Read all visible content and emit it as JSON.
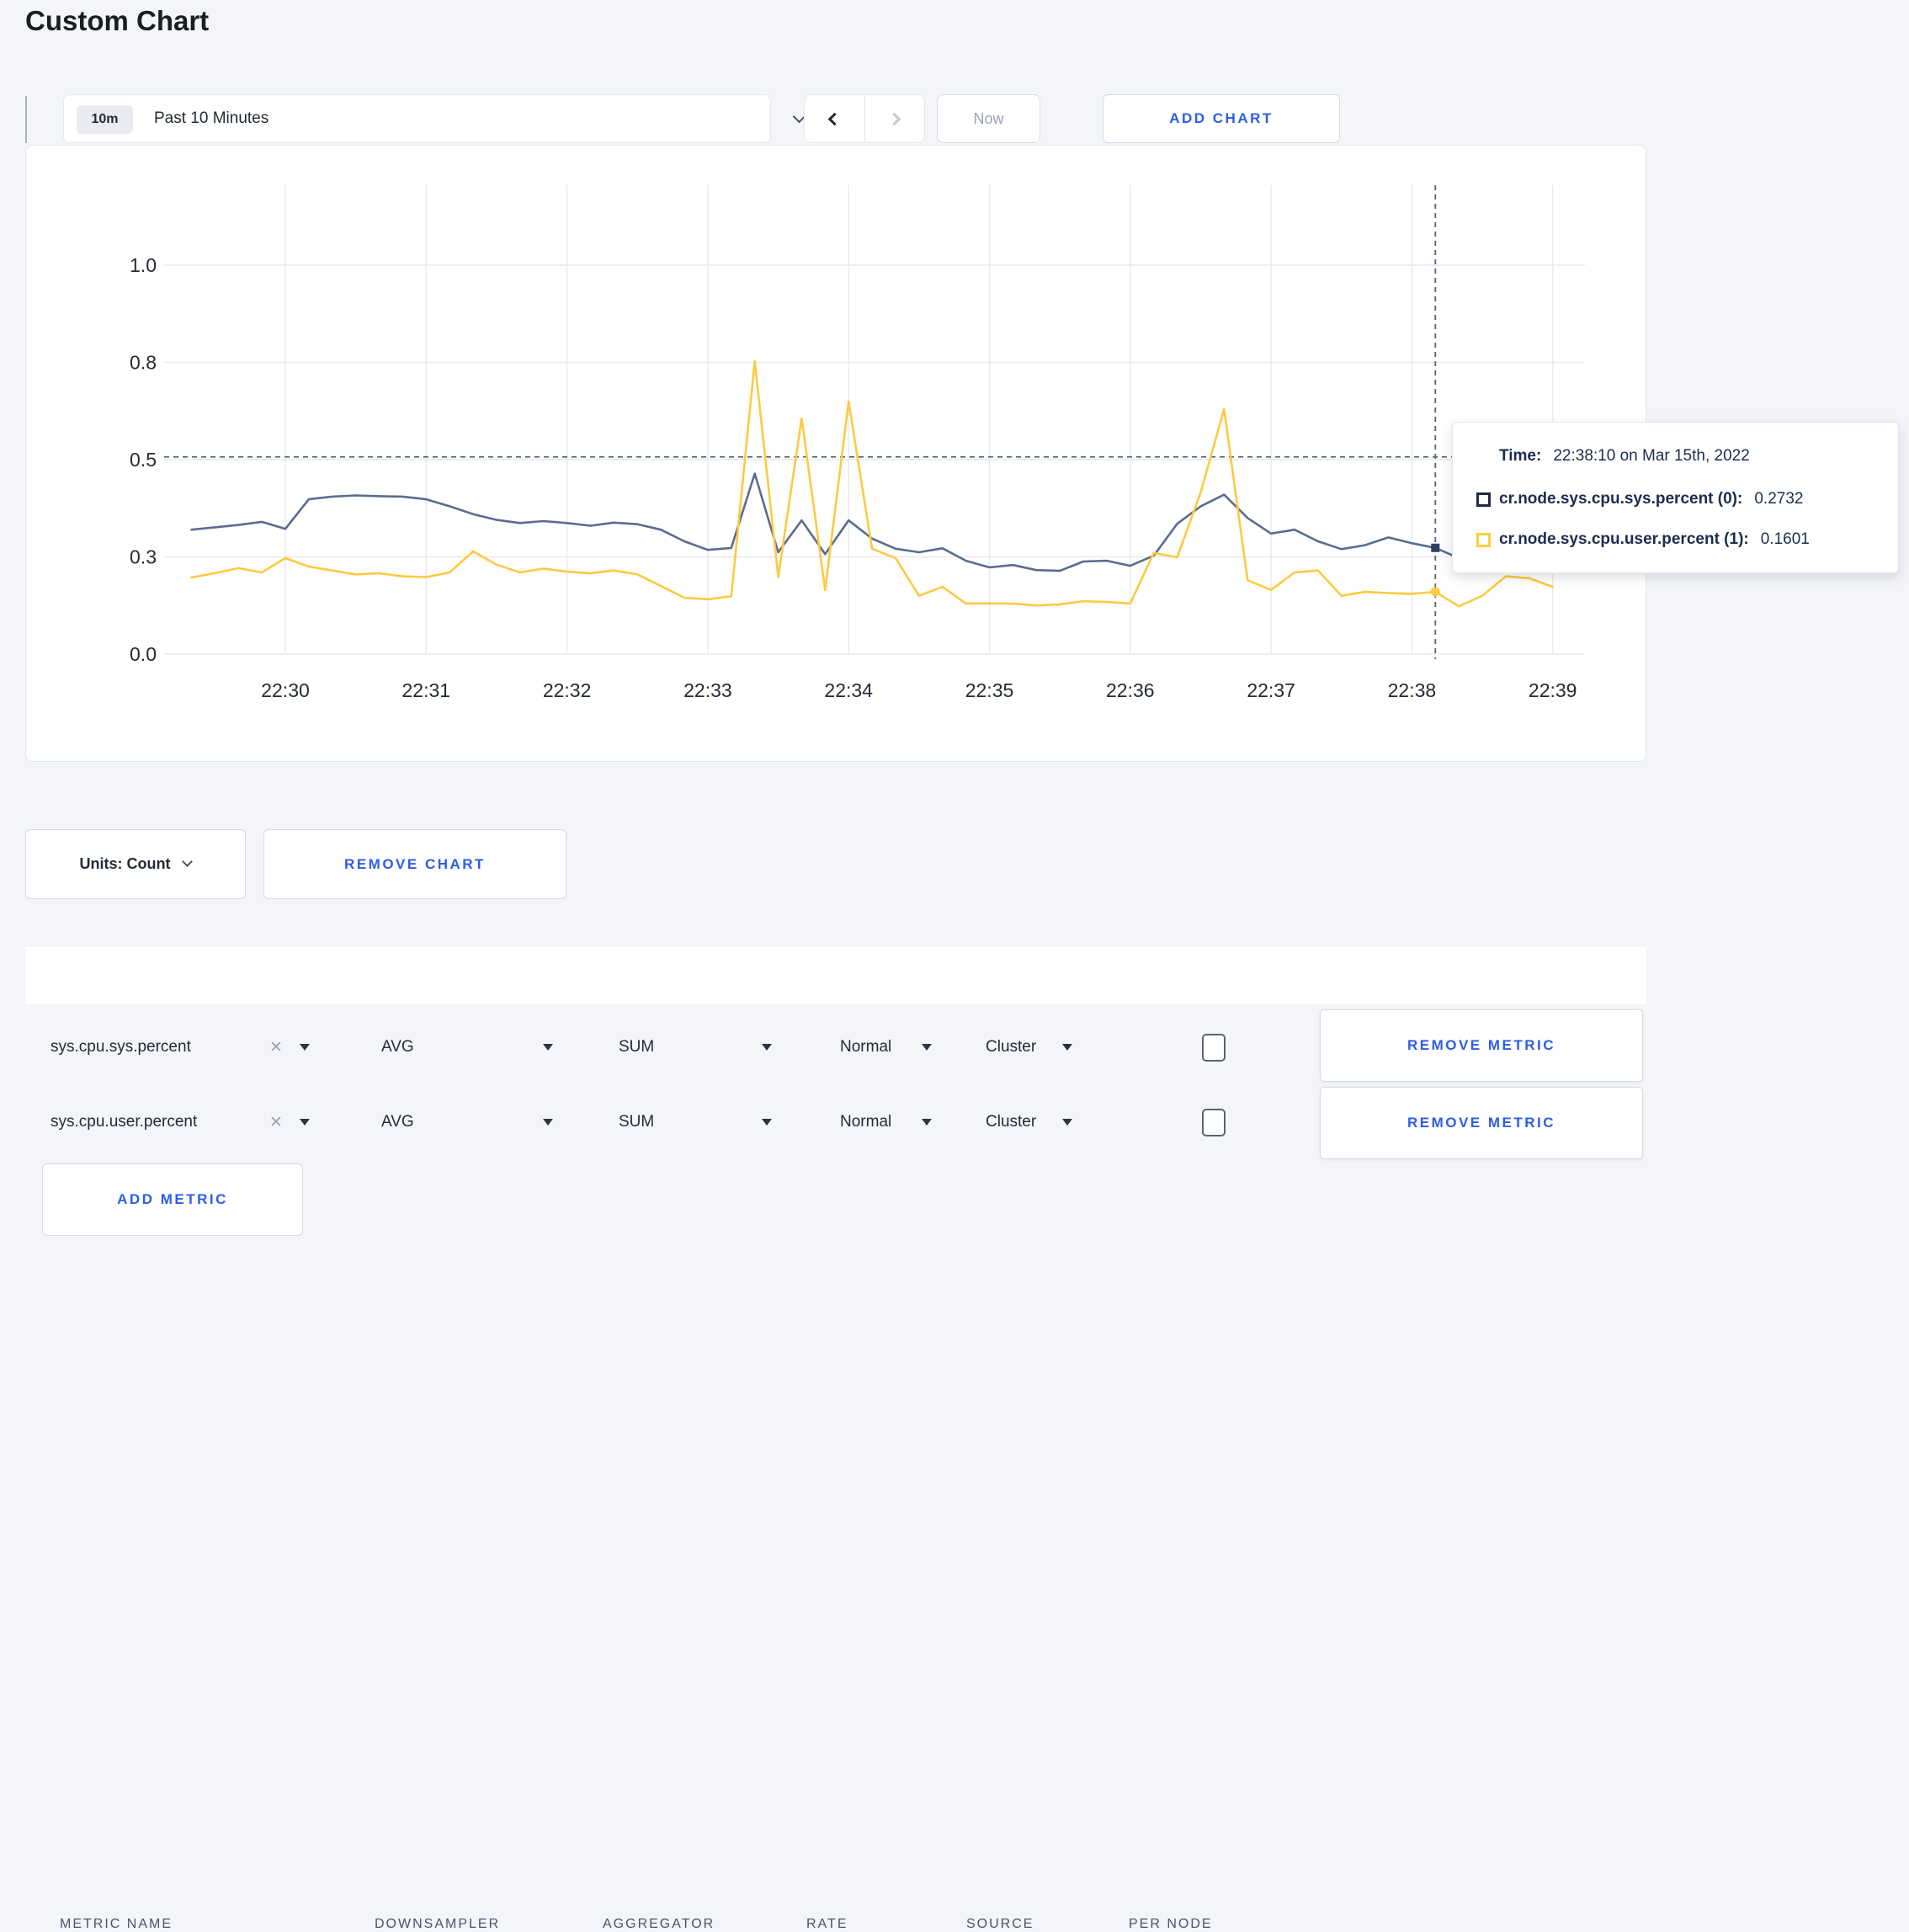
{
  "page": {
    "title": "Custom Chart"
  },
  "toolbar": {
    "range_badge": "10m",
    "range_label": "Past 10 Minutes",
    "now_label": "Now",
    "add_chart_label": "ADD CHART"
  },
  "colors": {
    "accent_blue": "#2c5de5",
    "series_sys": "#5b6c8f",
    "series_user": "#fdca40",
    "crosshair": "#51617f",
    "grid": "#e9eaee",
    "axis_text": "#242a35",
    "tooltip_text": "#1d2c4e",
    "page_bg": "#f4f5f9"
  },
  "chart_data": {
    "type": "line",
    "title": "",
    "xlabel": "",
    "ylabel": "",
    "ylim": [
      0,
      1
    ],
    "grid": true,
    "legend_position": "tooltip-only",
    "x_ticks": [
      {
        "label": "22:30",
        "min": 0
      },
      {
        "label": "22:31",
        "min": 1
      },
      {
        "label": "22:32",
        "min": 2
      },
      {
        "label": "22:33",
        "min": 3
      },
      {
        "label": "22:34",
        "min": 4
      },
      {
        "label": "22:35",
        "min": 5
      },
      {
        "label": "22:36",
        "min": 6
      },
      {
        "label": "22:37",
        "min": 7
      },
      {
        "label": "22:38",
        "min": 8
      },
      {
        "label": "22:39",
        "min": 9
      }
    ],
    "y_ticks": [
      {
        "label": "0.0",
        "value": 0.0
      },
      {
        "label": "0.3",
        "value": 0.25
      },
      {
        "label": "0.5",
        "value": 0.5
      },
      {
        "label": "0.8",
        "value": 0.75
      },
      {
        "label": "1.0",
        "value": 1.0
      }
    ],
    "series": [
      {
        "name": "cr.node.sys.cpu.sys.percent (0)",
        "color": "#5b6c8f",
        "points": [
          [
            -40,
            0.32
          ],
          [
            -30,
            0.326
          ],
          [
            -20,
            0.332
          ],
          [
            -10,
            0.34
          ],
          [
            0,
            0.322
          ],
          [
            10,
            0.398
          ],
          [
            20,
            0.405
          ],
          [
            30,
            0.408
          ],
          [
            40,
            0.406
          ],
          [
            50,
            0.405
          ],
          [
            60,
            0.398
          ],
          [
            70,
            0.38
          ],
          [
            80,
            0.36
          ],
          [
            90,
            0.345
          ],
          [
            100,
            0.337
          ],
          [
            110,
            0.342
          ],
          [
            120,
            0.337
          ],
          [
            130,
            0.33
          ],
          [
            140,
            0.338
          ],
          [
            150,
            0.334
          ],
          [
            160,
            0.32
          ],
          [
            170,
            0.29
          ],
          [
            180,
            0.268
          ],
          [
            190,
            0.273
          ],
          [
            200,
            0.464
          ],
          [
            210,
            0.262
          ],
          [
            220,
            0.344
          ],
          [
            230,
            0.257
          ],
          [
            240,
            0.344
          ],
          [
            250,
            0.297
          ],
          [
            260,
            0.271
          ],
          [
            270,
            0.262
          ],
          [
            280,
            0.272
          ],
          [
            290,
            0.24
          ],
          [
            300,
            0.223
          ],
          [
            310,
            0.229
          ],
          [
            320,
            0.216
          ],
          [
            330,
            0.214
          ],
          [
            340,
            0.238
          ],
          [
            350,
            0.24
          ],
          [
            360,
            0.227
          ],
          [
            370,
            0.253
          ],
          [
            380,
            0.335
          ],
          [
            390,
            0.38
          ],
          [
            400,
            0.41
          ],
          [
            410,
            0.35
          ],
          [
            420,
            0.31
          ],
          [
            430,
            0.32
          ],
          [
            440,
            0.29
          ],
          [
            450,
            0.27
          ],
          [
            460,
            0.28
          ],
          [
            470,
            0.3
          ],
          [
            480,
            0.285
          ],
          [
            490,
            0.2732
          ],
          [
            500,
            0.247
          ],
          [
            510,
            0.262
          ],
          [
            520,
            0.285
          ],
          [
            530,
            0.3
          ],
          [
            540,
            0.31
          ]
        ]
      },
      {
        "name": "cr.node.sys.cpu.user.percent (1)",
        "color": "#fdca40",
        "points": [
          [
            -40,
            0.197
          ],
          [
            -30,
            0.208
          ],
          [
            -20,
            0.221
          ],
          [
            -10,
            0.21
          ],
          [
            0,
            0.247
          ],
          [
            10,
            0.225
          ],
          [
            20,
            0.215
          ],
          [
            30,
            0.205
          ],
          [
            40,
            0.208
          ],
          [
            50,
            0.2
          ],
          [
            60,
            0.198
          ],
          [
            70,
            0.21
          ],
          [
            80,
            0.264
          ],
          [
            90,
            0.23
          ],
          [
            100,
            0.21
          ],
          [
            110,
            0.22
          ],
          [
            120,
            0.212
          ],
          [
            130,
            0.208
          ],
          [
            140,
            0.215
          ],
          [
            150,
            0.205
          ],
          [
            160,
            0.175
          ],
          [
            170,
            0.145
          ],
          [
            180,
            0.141
          ],
          [
            190,
            0.149
          ],
          [
            200,
            0.753
          ],
          [
            210,
            0.198
          ],
          [
            220,
            0.606
          ],
          [
            230,
            0.165
          ],
          [
            240,
            0.649
          ],
          [
            250,
            0.271
          ],
          [
            260,
            0.247
          ],
          [
            270,
            0.15
          ],
          [
            280,
            0.173
          ],
          [
            290,
            0.13
          ],
          [
            300,
            0.13
          ],
          [
            310,
            0.13
          ],
          [
            320,
            0.125
          ],
          [
            330,
            0.128
          ],
          [
            340,
            0.136
          ],
          [
            350,
            0.134
          ],
          [
            360,
            0.13
          ],
          [
            370,
            0.26
          ],
          [
            380,
            0.249
          ],
          [
            390,
            0.416
          ],
          [
            400,
            0.63
          ],
          [
            410,
            0.19
          ],
          [
            420,
            0.165
          ],
          [
            430,
            0.21
          ],
          [
            440,
            0.215
          ],
          [
            450,
            0.15
          ],
          [
            460,
            0.16
          ],
          [
            470,
            0.157
          ],
          [
            480,
            0.155
          ],
          [
            490,
            0.1601
          ],
          [
            500,
            0.123
          ],
          [
            510,
            0.15
          ],
          [
            520,
            0.2
          ],
          [
            530,
            0.195
          ],
          [
            540,
            0.173
          ]
        ]
      }
    ],
    "crosshair": {
      "time_sec_after_2230": 490,
      "h_line_value": 0.507,
      "sys_dot_value": 0.2732,
      "user_dot_value": 0.1601
    }
  },
  "tooltip": {
    "time_label": "Time:",
    "time_value": "22:38:10 on Mar 15th, 2022",
    "rows": [
      {
        "label": "cr.node.sys.cpu.sys.percent (0):",
        "value": "0.2732",
        "swatch_color": "#1c2b49"
      },
      {
        "label": "cr.node.sys.cpu.user.percent (1):",
        "value": "0.1601",
        "swatch_color": "#ffcd40"
      }
    ]
  },
  "units_bar": {
    "units_label": "Units: Count",
    "remove_chart_label": "REMOVE CHART"
  },
  "table": {
    "headers": [
      "METRIC NAME",
      "DOWNSAMPLER",
      "AGGREGATOR",
      "RATE",
      "SOURCE",
      "PER NODE"
    ],
    "rows": [
      {
        "metric": "sys.cpu.sys.percent",
        "downsampler": "AVG",
        "aggregator": "SUM",
        "rate": "Normal",
        "source": "Cluster",
        "per_node_checked": false,
        "remove_label": "REMOVE METRIC"
      },
      {
        "metric": "sys.cpu.user.percent",
        "downsampler": "AVG",
        "aggregator": "SUM",
        "rate": "Normal",
        "source": "Cluster",
        "per_node_checked": false,
        "remove_label": "REMOVE METRIC"
      }
    ],
    "add_metric_label": "ADD METRIC"
  }
}
